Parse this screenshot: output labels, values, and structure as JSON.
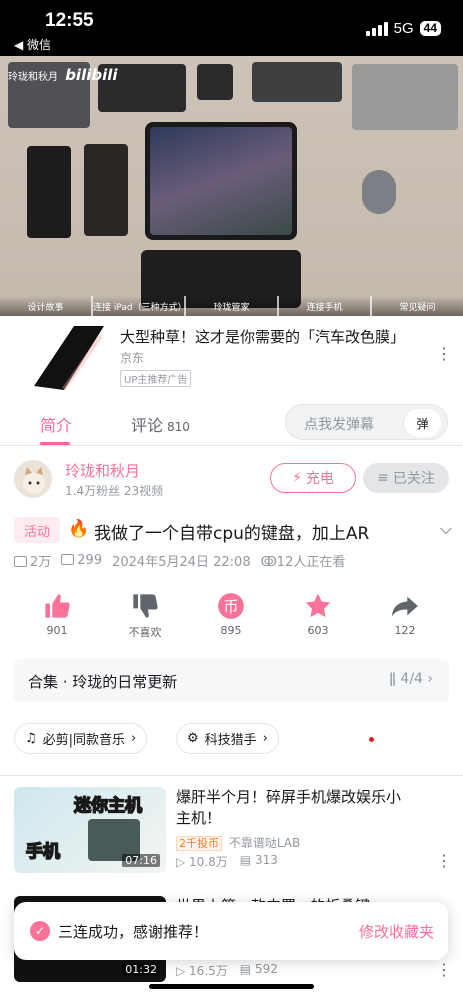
{
  "status_bar": {
    "time": "12:55",
    "back_app": "◀ 微信",
    "network": "5G",
    "battery": "44"
  },
  "player": {
    "uploader_watermark": "玲珑和秋月",
    "brand_watermark": "bilibili",
    "chapters": [
      "设计故事",
      "连接 iPad（三种方式）",
      "玲珑管家",
      "连接手机",
      "常见疑问"
    ]
  },
  "ad": {
    "title": "大型种草！这才是你需要的「汽车改色膜」",
    "brand": "京东",
    "tag": "UP主推荐广告"
  },
  "tabs": {
    "intro": "简介",
    "comments": "评论",
    "comments_count": "810",
    "danmu_placeholder": "点我发弹幕",
    "danmu_button": "弹"
  },
  "uploader": {
    "name": "玲珑和秋月",
    "stats": "1.4万粉丝  23视频",
    "charge_label": "充电",
    "follow_label": "已关注"
  },
  "video": {
    "activity_tag": "活动",
    "title": "我做了一个自带cpu的键盘，加上AR",
    "views": "2万",
    "danmaku": "299",
    "date": "2024年5月24日 22:08",
    "watching": "12人正在看"
  },
  "actions": {
    "like": "901",
    "dislike": "不喜欢",
    "coin": "895",
    "favorite": "603",
    "share": "122"
  },
  "collection": {
    "title": "合集 · 玲珑的日常更新",
    "progress": "4/4"
  },
  "chips": {
    "music": "必剪|同款音乐",
    "tech": "科技猎手"
  },
  "recommendations": [
    {
      "title": "爆肝半个月！碎屏手机爆改娱乐小主机！",
      "coin_tag": "2千投币",
      "author": "不靠谱哒LAB",
      "views": "10.8万",
      "danmaku": "313",
      "duration": "07:16",
      "thumb_text_top": "迷你主机",
      "thumb_text_bottom": "手机"
    },
    {
      "title": "世界上第一款内置...的折叠键",
      "views": "16.5万",
      "danmaku": "592",
      "duration": "01:32"
    }
  ],
  "toast": {
    "message": "三连成功，感谢推荐！",
    "link": "修改收藏夹"
  },
  "colors": {
    "pink": "#fb7299",
    "gray_text": "#9499a0"
  }
}
